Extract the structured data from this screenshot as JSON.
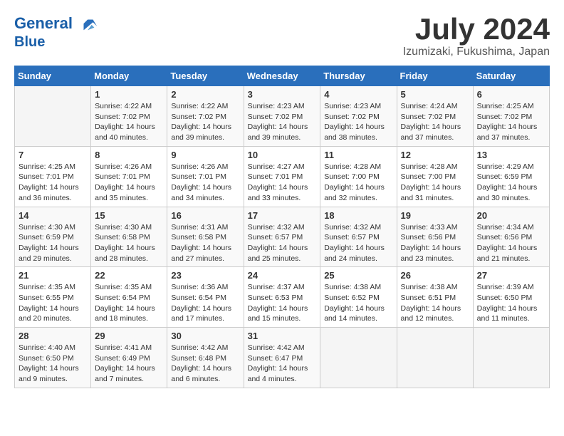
{
  "header": {
    "logo_line1": "General",
    "logo_line2": "Blue",
    "month": "July 2024",
    "location": "Izumizaki, Fukushima, Japan"
  },
  "weekdays": [
    "Sunday",
    "Monday",
    "Tuesday",
    "Wednesday",
    "Thursday",
    "Friday",
    "Saturday"
  ],
  "weeks": [
    [
      {
        "day": "",
        "text": ""
      },
      {
        "day": "1",
        "text": "Sunrise: 4:22 AM\nSunset: 7:02 PM\nDaylight: 14 hours\nand 40 minutes."
      },
      {
        "day": "2",
        "text": "Sunrise: 4:22 AM\nSunset: 7:02 PM\nDaylight: 14 hours\nand 39 minutes."
      },
      {
        "day": "3",
        "text": "Sunrise: 4:23 AM\nSunset: 7:02 PM\nDaylight: 14 hours\nand 39 minutes."
      },
      {
        "day": "4",
        "text": "Sunrise: 4:23 AM\nSunset: 7:02 PM\nDaylight: 14 hours\nand 38 minutes."
      },
      {
        "day": "5",
        "text": "Sunrise: 4:24 AM\nSunset: 7:02 PM\nDaylight: 14 hours\nand 37 minutes."
      },
      {
        "day": "6",
        "text": "Sunrise: 4:25 AM\nSunset: 7:02 PM\nDaylight: 14 hours\nand 37 minutes."
      }
    ],
    [
      {
        "day": "7",
        "text": "Sunrise: 4:25 AM\nSunset: 7:01 PM\nDaylight: 14 hours\nand 36 minutes."
      },
      {
        "day": "8",
        "text": "Sunrise: 4:26 AM\nSunset: 7:01 PM\nDaylight: 14 hours\nand 35 minutes."
      },
      {
        "day": "9",
        "text": "Sunrise: 4:26 AM\nSunset: 7:01 PM\nDaylight: 14 hours\nand 34 minutes."
      },
      {
        "day": "10",
        "text": "Sunrise: 4:27 AM\nSunset: 7:01 PM\nDaylight: 14 hours\nand 33 minutes."
      },
      {
        "day": "11",
        "text": "Sunrise: 4:28 AM\nSunset: 7:00 PM\nDaylight: 14 hours\nand 32 minutes."
      },
      {
        "day": "12",
        "text": "Sunrise: 4:28 AM\nSunset: 7:00 PM\nDaylight: 14 hours\nand 31 minutes."
      },
      {
        "day": "13",
        "text": "Sunrise: 4:29 AM\nSunset: 6:59 PM\nDaylight: 14 hours\nand 30 minutes."
      }
    ],
    [
      {
        "day": "14",
        "text": "Sunrise: 4:30 AM\nSunset: 6:59 PM\nDaylight: 14 hours\nand 29 minutes."
      },
      {
        "day": "15",
        "text": "Sunrise: 4:30 AM\nSunset: 6:58 PM\nDaylight: 14 hours\nand 28 minutes."
      },
      {
        "day": "16",
        "text": "Sunrise: 4:31 AM\nSunset: 6:58 PM\nDaylight: 14 hours\nand 27 minutes."
      },
      {
        "day": "17",
        "text": "Sunrise: 4:32 AM\nSunset: 6:57 PM\nDaylight: 14 hours\nand 25 minutes."
      },
      {
        "day": "18",
        "text": "Sunrise: 4:32 AM\nSunset: 6:57 PM\nDaylight: 14 hours\nand 24 minutes."
      },
      {
        "day": "19",
        "text": "Sunrise: 4:33 AM\nSunset: 6:56 PM\nDaylight: 14 hours\nand 23 minutes."
      },
      {
        "day": "20",
        "text": "Sunrise: 4:34 AM\nSunset: 6:56 PM\nDaylight: 14 hours\nand 21 minutes."
      }
    ],
    [
      {
        "day": "21",
        "text": "Sunrise: 4:35 AM\nSunset: 6:55 PM\nDaylight: 14 hours\nand 20 minutes."
      },
      {
        "day": "22",
        "text": "Sunrise: 4:35 AM\nSunset: 6:54 PM\nDaylight: 14 hours\nand 18 minutes."
      },
      {
        "day": "23",
        "text": "Sunrise: 4:36 AM\nSunset: 6:54 PM\nDaylight: 14 hours\nand 17 minutes."
      },
      {
        "day": "24",
        "text": "Sunrise: 4:37 AM\nSunset: 6:53 PM\nDaylight: 14 hours\nand 15 minutes."
      },
      {
        "day": "25",
        "text": "Sunrise: 4:38 AM\nSunset: 6:52 PM\nDaylight: 14 hours\nand 14 minutes."
      },
      {
        "day": "26",
        "text": "Sunrise: 4:38 AM\nSunset: 6:51 PM\nDaylight: 14 hours\nand 12 minutes."
      },
      {
        "day": "27",
        "text": "Sunrise: 4:39 AM\nSunset: 6:50 PM\nDaylight: 14 hours\nand 11 minutes."
      }
    ],
    [
      {
        "day": "28",
        "text": "Sunrise: 4:40 AM\nSunset: 6:50 PM\nDaylight: 14 hours\nand 9 minutes."
      },
      {
        "day": "29",
        "text": "Sunrise: 4:41 AM\nSunset: 6:49 PM\nDaylight: 14 hours\nand 7 minutes."
      },
      {
        "day": "30",
        "text": "Sunrise: 4:42 AM\nSunset: 6:48 PM\nDaylight: 14 hours\nand 6 minutes."
      },
      {
        "day": "31",
        "text": "Sunrise: 4:42 AM\nSunset: 6:47 PM\nDaylight: 14 hours\nand 4 minutes."
      },
      {
        "day": "",
        "text": ""
      },
      {
        "day": "",
        "text": ""
      },
      {
        "day": "",
        "text": ""
      }
    ]
  ]
}
